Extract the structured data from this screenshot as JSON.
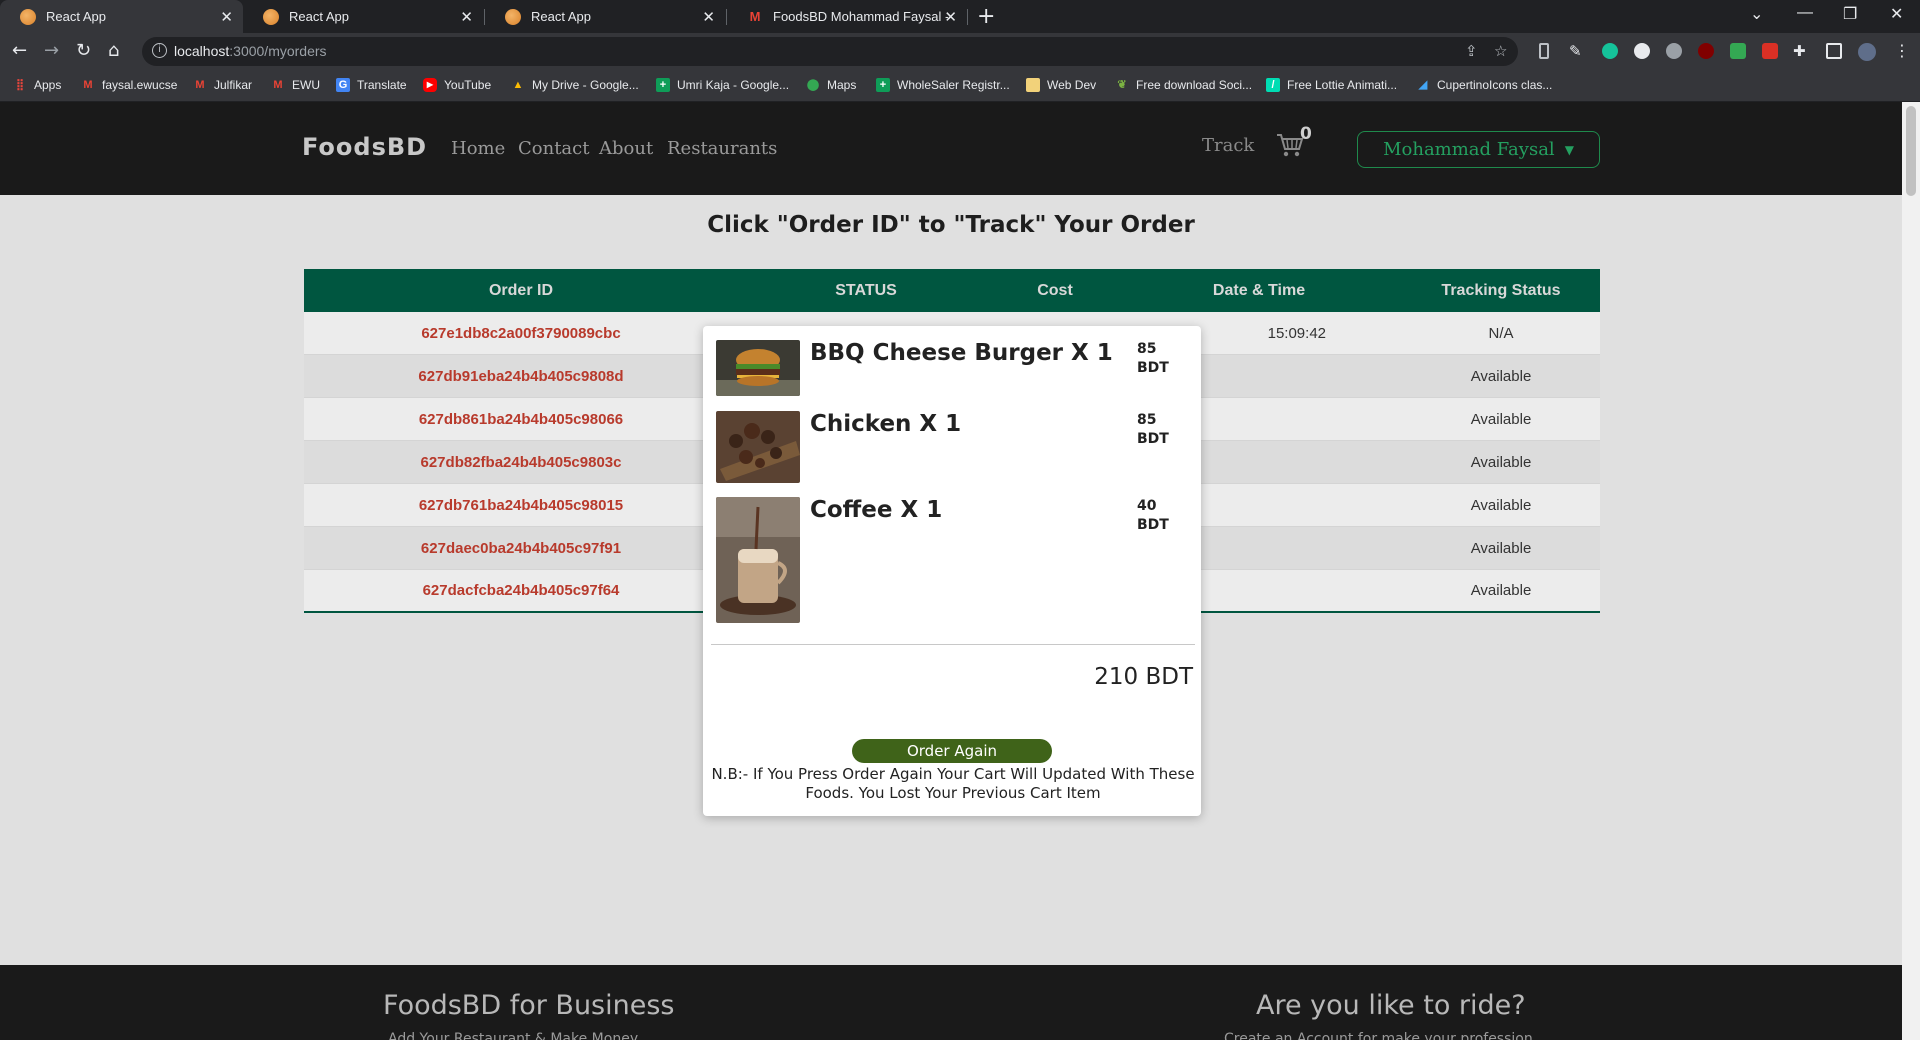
{
  "browser": {
    "tabs": [
      {
        "title": "React App",
        "icon": "react-app-favicon"
      },
      {
        "title": "React App",
        "icon": "react-app-favicon"
      },
      {
        "title": "React App",
        "icon": "react-app-favicon"
      },
      {
        "title": "FoodsBD Mohammad Faysal - fa",
        "icon": "gmail-favicon"
      }
    ],
    "new_tab_glyph": "+",
    "url_host": "localhost",
    "url_path": ":3000/myorders",
    "bookmarks": [
      {
        "label": "Apps",
        "icon": "apps-grid-icon",
        "color": "#e8453c"
      },
      {
        "label": "faysal.ewucse",
        "icon": "gmail-icon",
        "color": "#ea4335"
      },
      {
        "label": "Julfikar",
        "icon": "gmail-icon",
        "color": "#ea4335"
      },
      {
        "label": "EWU",
        "icon": "gmail-icon",
        "color": "#ea4335"
      },
      {
        "label": "Translate",
        "icon": "translate-icon",
        "color": "#4285f4"
      },
      {
        "label": "YouTube",
        "icon": "youtube-icon",
        "color": "#ff0000"
      },
      {
        "label": "My Drive - Google...",
        "icon": "drive-icon",
        "color": "#fbbc04"
      },
      {
        "label": "Umri Kaja - Google...",
        "icon": "sheets-icon",
        "color": "#0f9d58"
      },
      {
        "label": "Maps",
        "icon": "maps-icon",
        "color": "#34a853"
      },
      {
        "label": "WholeSaler Registr...",
        "icon": "sheets-icon",
        "color": "#0f9d58"
      },
      {
        "label": "Web Dev",
        "icon": "folder-icon",
        "color": "#f2d27a"
      },
      {
        "label": "Free download Soci...",
        "icon": "leaf-icon",
        "color": "#7cb342"
      },
      {
        "label": "Free Lottie Animati...",
        "icon": "lottie-icon",
        "color": "#00ddb3"
      },
      {
        "label": "CupertinoIcons clas...",
        "icon": "flutter-icon",
        "color": "#42a5f5"
      }
    ]
  },
  "nav": {
    "brand": "FoodsBD",
    "links": [
      "Home",
      "Contact",
      "About",
      "Restaurants"
    ],
    "track": "Track",
    "cart_count": "0",
    "user": "Mohammad Faysal"
  },
  "orders": {
    "heading": "Click \"Order ID\" to \"Track\" Your Order",
    "columns": [
      "Order ID",
      "STATUS",
      "Cost",
      "Date & Time",
      "Tracking Status"
    ],
    "rows": [
      {
        "id": "627e1db8c2a00f3790089cbc",
        "datetime": "15:09:42",
        "tracking": "N/A"
      },
      {
        "id": "627db91eba24b4b405c9808d",
        "tracking": "Available"
      },
      {
        "id": "627db861ba24b4b405c98066",
        "tracking": "Available"
      },
      {
        "id": "627db82fba24b4b405c9803c",
        "tracking": "Available"
      },
      {
        "id": "627db761ba24b4b405c98015",
        "tracking": "Available"
      },
      {
        "id": "627daec0ba24b4b405c97f91",
        "tracking": "Available"
      },
      {
        "id": "627dacfcba24b4b405c97f64",
        "tracking": "Available"
      }
    ]
  },
  "modal": {
    "items": [
      {
        "name": "BBQ Cheese Burger X 1",
        "price": "85",
        "unit": "BDT",
        "image": "burger-photo"
      },
      {
        "name": "Chicken X 1",
        "price": "85",
        "unit": "BDT",
        "image": "chicken-photo"
      },
      {
        "name": "Coffee X 1",
        "price": "40",
        "unit": "BDT",
        "image": "coffee-photo"
      }
    ],
    "total": "210 BDT",
    "order_again": "Order Again",
    "note": "N.B:- If You Press Order Again Your Cart Will Updated With These Foods. You Lost Your Previous Cart Item"
  },
  "footer": {
    "business_title": "FoodsBD for Business",
    "business_sub": "Add Your Restaurant & Make Money",
    "ride_title": "Are you like to ride?",
    "ride_sub": "Create an Account for make your profession"
  }
}
